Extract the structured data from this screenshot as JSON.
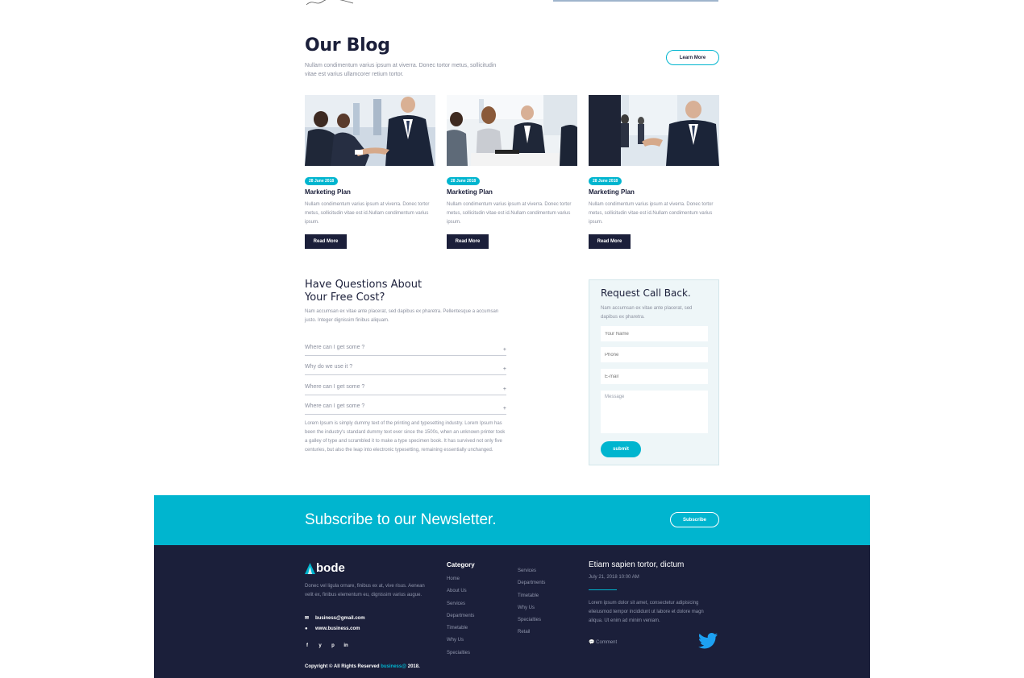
{
  "blog": {
    "title": "Our Blog",
    "description": "Nullam condimentum varius ipsum at viverra. Donec tortor metus, sollicitudin vitae est varius ullamcorer retium tortor.",
    "learn_more": "Learn More",
    "cards": [
      {
        "date": "28 June 2018",
        "title": "Marketing Plan",
        "text": "Nullam condimentum varius ipsum at viverra. Donec tortor metus, sollicitudin vitae est id.Nullam condimentum varius ipsum.",
        "button": "Read More"
      },
      {
        "date": "28 June 2018",
        "title": "Marketing Plan",
        "text": "Nullam condimentum varius ipsum at viverra. Donec tortor metus, sollicitudin vitae est id.Nullam condimentum varius ipsum.",
        "button": "Read More"
      },
      {
        "date": "28 June 2018",
        "title": "Marketing Plan",
        "text": "Nullam condimentum varius ipsum at viverra. Donec tortor metus, sollicitudin vitae est id.Nullam condimentum varius ipsum.",
        "button": "Read More"
      }
    ]
  },
  "questions": {
    "title_line1": "Have Questions About",
    "title_line2": "Your Free Cost?",
    "description": "Nam accumsan ex vitae ante placerat, sed dapibus ex pharetra. Pellentesque a accumsan justo. Integer dignissim finibus aliquam.",
    "faqs": [
      {
        "q": "Where can I get some ?",
        "icon": "+"
      },
      {
        "q": "Why do we use it ?",
        "icon": "+"
      },
      {
        "q": "Where can I get some ?",
        "icon": "+"
      },
      {
        "q": "Where can I get some ?",
        "icon": "+"
      }
    ],
    "answer": "Lorem Ipsum is simply dummy text of the printing and typesetting industry. Lorem Ipsum has been the industry's standard dummy text ever since the 1500s, when an unknown printer took a galley of type and scrambled it to make a type specimen book. It has survived not only five centuries, but also the leap into electronic typesetting, remaining essentially unchanged."
  },
  "request": {
    "title": "Request Call Back.",
    "description": "Nam accumsan ex vitae ante placerat, sed dapibus ex pharetra.",
    "name_placeholder": "Your Name",
    "phone_placeholder": "Phone",
    "email_placeholder": "E-mail",
    "message_placeholder": "Message",
    "submit": "submit"
  },
  "newsletter": {
    "title": "Subscribe to our Newsletter.",
    "button": "Subscribe"
  },
  "footer": {
    "logo": "bode",
    "description": "Donec vel ligula ornare, finibus ex at, vive risus. Aenean velit ex, finibus elementum eu, dignissim varius augue.",
    "email": "business@gmail.com",
    "website": "www.business.com",
    "social": [
      "f",
      "y",
      "p",
      "in"
    ],
    "copyright_prefix": "Copyright © All Rights Reserved ",
    "copyright_link": "business@",
    "copyright_suffix": " 2018.",
    "category_title": "Category",
    "category_col1": [
      "Home",
      "About Us",
      "Services",
      "Departments",
      "Timetable",
      "Why Us",
      "Specialties"
    ],
    "category_col2": [
      "Services",
      "Departments",
      "Timetable",
      "Why Us",
      "Specialties",
      "Retail"
    ],
    "post_title": "Etiam sapien tortor, dictum",
    "post_date": "July 21, 2018 10:00 AM",
    "post_text": "Lorem ipsum dolor sit amet, consectetur adipisicing elieiusmod tempor incididunt ut labore et dolore magn aliqua. Ut enim ad minim veniam.",
    "comment": "Comment"
  },
  "colors": {
    "accent": "#00b5cf",
    "dark": "#1b1f3a",
    "muted": "#8a8f9e"
  }
}
